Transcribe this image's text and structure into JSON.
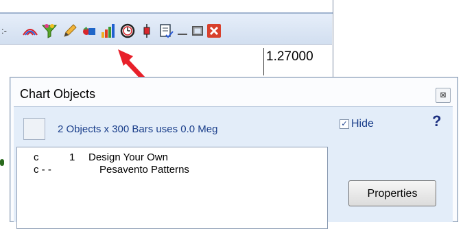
{
  "toolbar": {
    "partial_label": ":-",
    "icons": [
      "fibonacci-arcs-icon",
      "filter-funnel-icon",
      "pencil-icon",
      "chart-objects-icon",
      "bar-chart-icon",
      "clock-icon",
      "candlestick-icon",
      "checklist-icon"
    ],
    "window_buttons": [
      "minimize",
      "maximize",
      "close"
    ]
  },
  "chart": {
    "price_label": "1.27000"
  },
  "dialog": {
    "title": "Chart Objects",
    "status_text": "2 Objects x 300 Bars uses 0.0 Meg",
    "hide_label": "Hide",
    "hide_checked": true,
    "help_label": "?",
    "properties_label": "Properties",
    "objects": [
      {
        "col1": "c",
        "col2": "1",
        "name": "Design Your Own"
      },
      {
        "col1": "c - -",
        "col2": "",
        "name": "Pesavento Patterns"
      }
    ]
  },
  "colors": {
    "arrow": "#e8202a",
    "status_text": "#1b3f8b",
    "dialog_body": "#e3edf9"
  }
}
